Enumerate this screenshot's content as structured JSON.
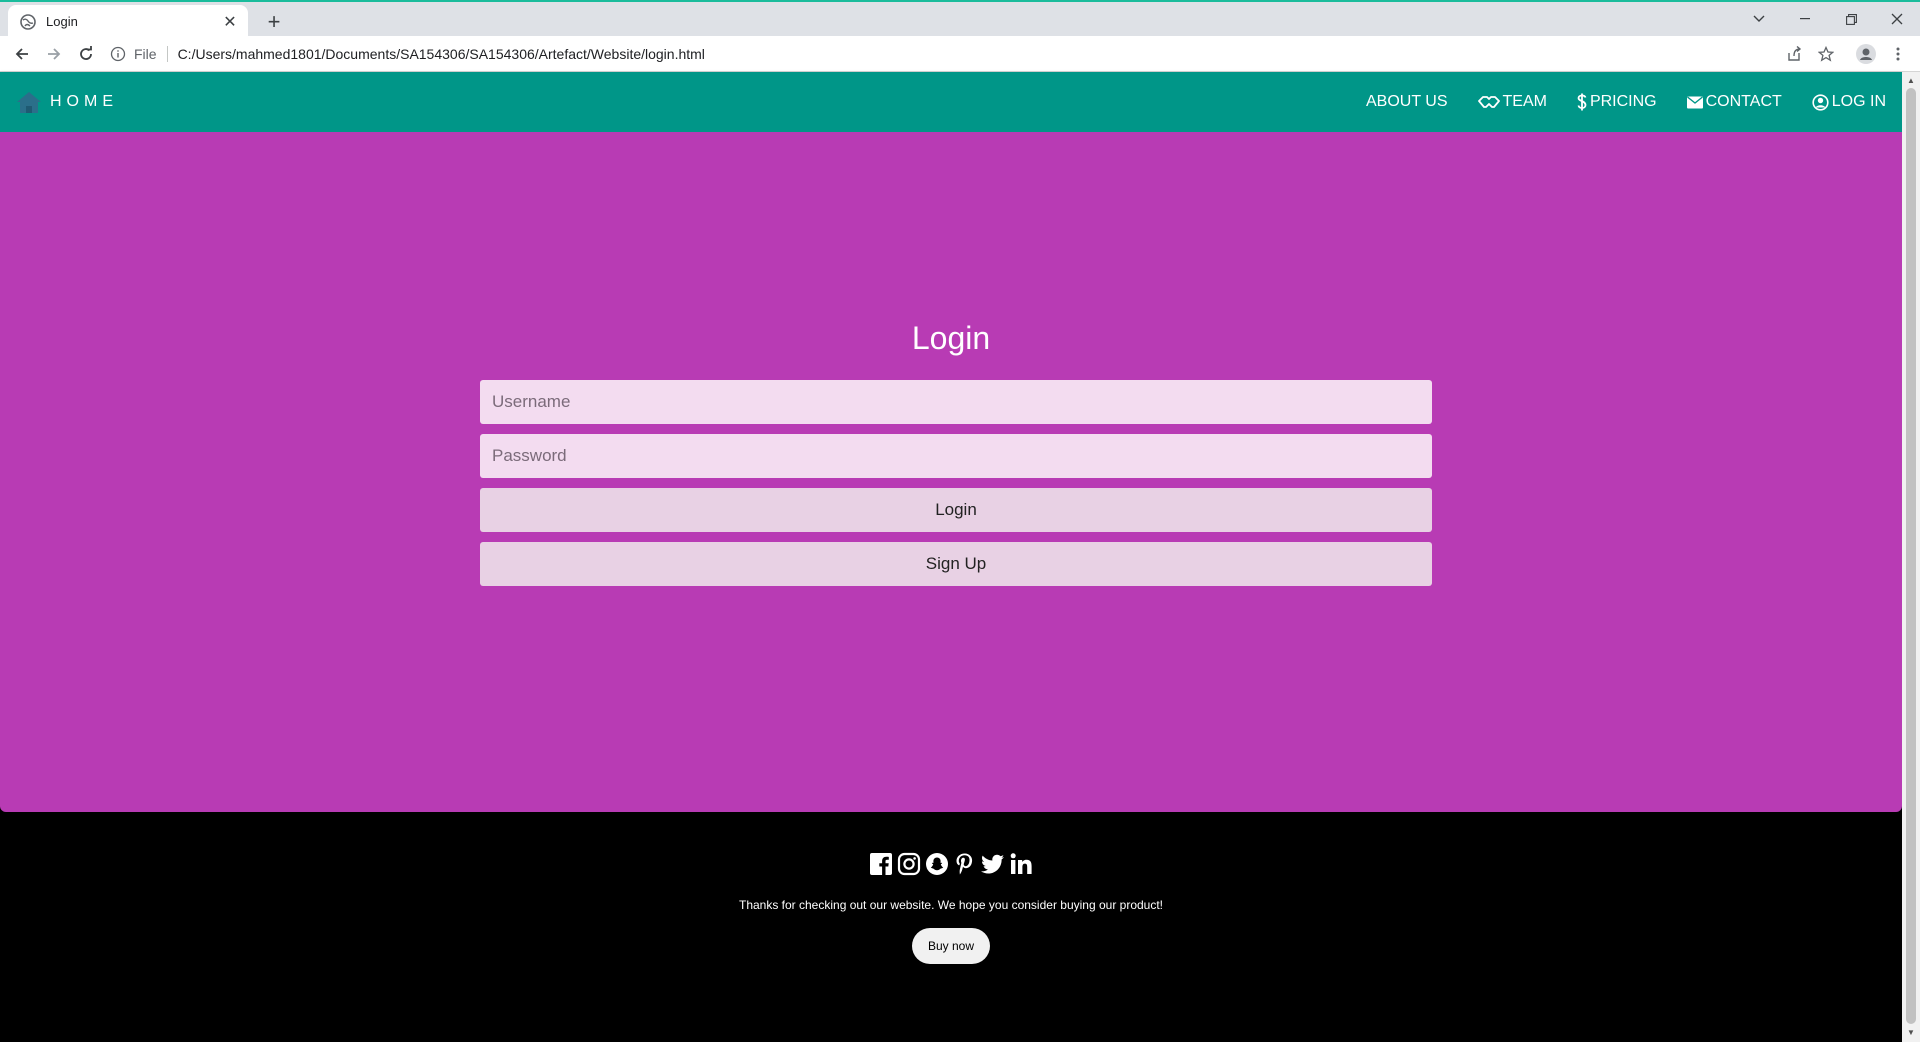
{
  "browser": {
    "tab_title": "Login",
    "url_scheme_label": "File",
    "url": "C:/Users/mahmed1801/Documents/SA154306/SA154306/Artefact/Website/login.html"
  },
  "navbar": {
    "home_label": "HOME",
    "links": [
      {
        "label": "ABOUT US",
        "icon": ""
      },
      {
        "label": "TEAM",
        "icon": "handshake-icon"
      },
      {
        "label": "PRICING",
        "icon": "dollar-icon"
      },
      {
        "label": "CONTACT",
        "icon": "envelope-icon"
      },
      {
        "label": "LOG IN",
        "icon": "user-circle-icon"
      }
    ]
  },
  "login": {
    "title": "Login",
    "username_placeholder": "Username",
    "password_placeholder": "Password",
    "login_button": "Login",
    "signup_button": "Sign Up"
  },
  "footer": {
    "social_icons": [
      "facebook-icon",
      "instagram-icon",
      "snapchat-icon",
      "pinterest-icon",
      "twitter-icon",
      "linkedin-icon"
    ],
    "message": "Thanks for checking out our website. We hope you consider buying our product!",
    "buy_button": "Buy now"
  },
  "colors": {
    "navbar": "#009688",
    "main_background": "#b83bb4",
    "input_background": "#f3dcf0",
    "button_background": "#e8d1e4",
    "footer_background": "#000000"
  }
}
